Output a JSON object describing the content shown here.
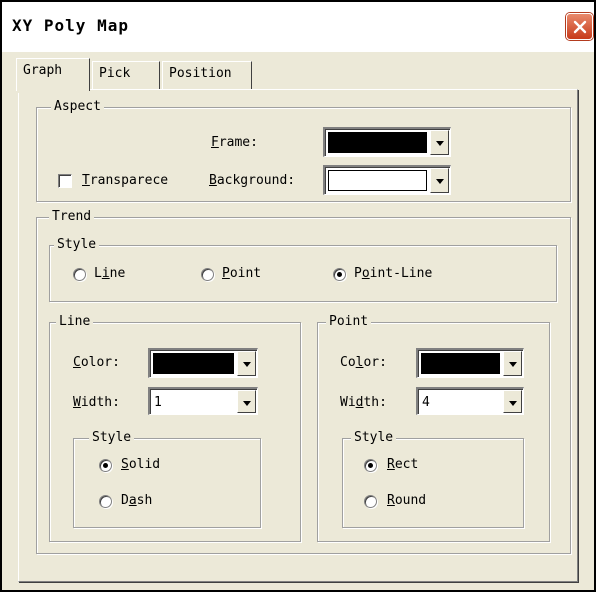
{
  "window": {
    "title": "XY Poly Map",
    "close_icon": "close-icon"
  },
  "tabs": [
    {
      "label": "Graph",
      "active": true
    },
    {
      "label": "Pick",
      "active": false
    },
    {
      "label": "Position",
      "active": false
    }
  ],
  "aspect": {
    "group_label": "Aspect",
    "frame_label_key": "F",
    "frame_label_rest": "rame:",
    "frame_color": "#000000",
    "background_label_key": "B",
    "background_label_rest": "ackground:",
    "background_color": "#ffffff",
    "transparence_key": "T",
    "transparence_rest": "ransparece",
    "transparence_checked": false
  },
  "trend": {
    "group_label": "Trend",
    "style": {
      "group_label": "Style",
      "options": [
        {
          "key": "i",
          "pre": "L",
          "post": "ne",
          "checked": false
        },
        {
          "key": "P",
          "pre": "",
          "post": "oint",
          "checked": false
        },
        {
          "key": "o",
          "pre": "P",
          "post": "int-Line",
          "checked": true
        }
      ]
    },
    "line": {
      "group_label": "Line",
      "color_key": "C",
      "color_rest": "olor:",
      "color_value": "#000000",
      "width_key": "W",
      "width_rest": "idth:",
      "width_value": "1",
      "style_label": "Style",
      "solid": {
        "key": "S",
        "rest": "olid",
        "checked": true
      },
      "dash": {
        "key": "a",
        "pre": "D",
        "post": "sh",
        "checked": false
      }
    },
    "point": {
      "group_label": "Point",
      "color_pre": "Co",
      "color_key": "l",
      "color_rest": "or:",
      "color_value": "#000000",
      "width_pre": "Wi",
      "width_key": "d",
      "width_rest": "th:",
      "width_value": "4",
      "style_label": "Style",
      "rect": {
        "key": "R",
        "rest": "ect",
        "checked": true
      },
      "round": {
        "key": "R",
        "rest": "ound",
        "checked": false
      }
    }
  }
}
